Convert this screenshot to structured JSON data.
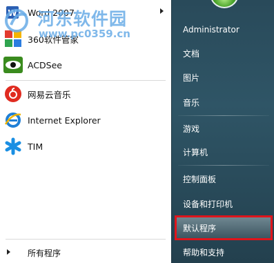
{
  "watermark": {
    "title": "河东软件园",
    "url": "www.pc0359.cn"
  },
  "programs": [
    {
      "label": "Word 2007",
      "icon": "word-icon",
      "has_submenu": true
    },
    {
      "label": "360软件管家",
      "icon": "360-software-manager-icon",
      "has_submenu": false
    },
    {
      "label": "ACDSee",
      "icon": "acdsee-icon",
      "has_submenu": false
    },
    {
      "label": "网易云音乐",
      "icon": "netease-music-icon",
      "has_submenu": false
    },
    {
      "label": "Internet Explorer",
      "icon": "internet-explorer-icon",
      "has_submenu": false
    },
    {
      "label": "TIM",
      "icon": "tim-icon",
      "has_submenu": false
    }
  ],
  "all_programs_label": "所有程序",
  "right_menu": {
    "items": [
      {
        "label": "Administrator"
      },
      {
        "label": "文档"
      },
      {
        "label": "图片"
      },
      {
        "label": "音乐"
      },
      {
        "label": "游戏"
      },
      {
        "label": "计算机"
      },
      {
        "label": "控制面板"
      },
      {
        "label": "设备和打印机"
      },
      {
        "label": "默认程序",
        "highlighted": true
      },
      {
        "label": "帮助和支持"
      }
    ]
  },
  "colors": {
    "right_pane": "#2f5566",
    "highlight_border": "#e0141b",
    "watermark": "#68ace6"
  }
}
